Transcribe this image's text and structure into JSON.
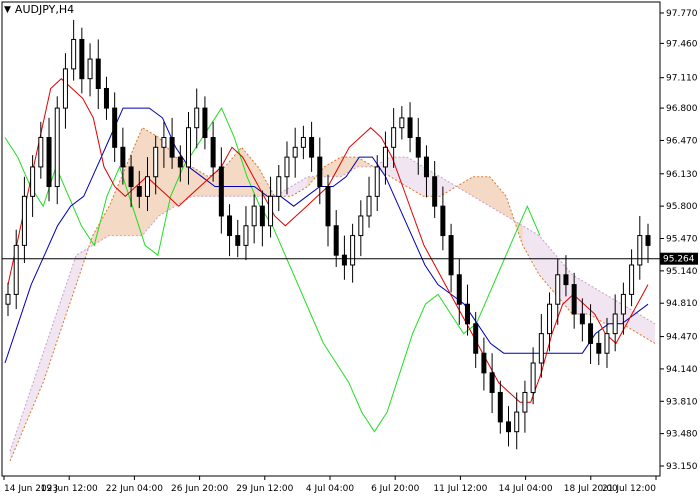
{
  "symbol_label": "AUDJPY,H4",
  "colors": {
    "background": "#ffffff",
    "candles": "#000000",
    "tenkan": "#e00000",
    "kijun": "#0000b4",
    "chikou": "#22dd22",
    "senkou_a": "#d8782c",
    "senkou_b": "#c8a0c8",
    "price_badge": "#000000"
  },
  "chart_data": {
    "type": "candlestick",
    "title": "AUDJPY,H4",
    "grid": false,
    "ylim": [
      93.15,
      97.78
    ],
    "y_ticks": [
      "97.770",
      "97.460",
      "97.110",
      "96.800",
      "96.470",
      "96.130",
      "95.800",
      "95.470",
      "95.140",
      "94.810",
      "94.470",
      "94.140",
      "93.810",
      "93.480",
      "93.150"
    ],
    "x_ticks": [
      "14 Jun 2023",
      "19 Jun 12:00",
      "22 Jun 04:00",
      "26 Jun 20:00",
      "29 Jun 12:00",
      "4 Jul 04:00",
      "6 Jul 20:00",
      "11 Jul 12:00",
      "14 Jul 04:00",
      "18 Jul 20:00",
      "21 Jul 12:00"
    ],
    "current_price": 95.264,
    "current_price_label": "95.264",
    "series": [
      {
        "name": "price",
        "kind": "ohlc_close_path",
        "close": [
          94.9,
          95.4,
          95.9,
          96.2,
          96.5,
          96.0,
          96.8,
          97.2,
          97.5,
          97.1,
          97.3,
          97.0,
          96.8,
          96.4,
          96.2,
          96.0,
          95.9,
          96.1,
          96.4,
          96.5,
          96.3,
          96.2,
          96.6,
          96.8,
          96.5,
          96.2,
          95.7,
          95.5,
          95.4,
          95.6,
          95.8,
          95.6,
          95.9,
          96.1,
          96.3,
          96.4,
          96.5,
          96.3,
          96.0,
          95.6,
          95.3,
          95.2,
          95.5,
          95.7,
          95.9,
          96.2,
          96.4,
          96.6,
          96.7,
          96.5,
          96.3,
          96.1,
          95.8,
          95.5,
          95.1,
          94.8,
          94.6,
          94.3,
          94.1,
          93.9,
          93.6,
          93.5,
          93.7,
          93.9,
          94.2,
          94.5,
          94.8,
          95.1,
          95.0,
          94.7,
          94.6,
          94.4,
          94.3,
          94.5,
          94.7,
          94.9,
          95.2,
          95.5,
          95.4
        ]
      },
      {
        "name": "tenkan",
        "values": [
          95.0,
          95.5,
          96.0,
          96.5,
          97.0,
          97.1,
          97.0,
          96.9,
          96.7,
          96.2,
          96.0,
          95.9,
          96.0,
          96.1,
          96.0,
          95.9,
          95.8,
          95.9,
          96.0,
          96.1,
          96.2,
          96.4,
          96.3,
          96.1,
          95.9,
          95.7,
          95.6,
          95.7,
          95.8,
          95.9,
          96.0,
          96.2,
          96.4,
          96.5,
          96.6,
          96.5,
          96.3,
          96.0,
          95.7,
          95.4,
          95.2,
          95.0,
          94.8,
          94.6,
          94.4,
          94.2,
          94.0,
          93.9,
          93.8,
          93.8,
          94.1,
          94.5,
          94.8,
          94.9,
          94.8,
          94.7,
          94.5,
          94.4,
          94.6,
          94.8,
          95.0
        ]
      },
      {
        "name": "kijun",
        "values": [
          94.2,
          94.6,
          95.0,
          95.3,
          95.6,
          95.8,
          95.9,
          96.2,
          96.5,
          96.8,
          96.8,
          96.8,
          96.7,
          96.4,
          96.2,
          96.1,
          96.0,
          96.0,
          96.0,
          96.0,
          95.9,
          95.9,
          95.8,
          95.9,
          96.0,
          96.0,
          96.1,
          96.3,
          96.3,
          96.1,
          95.8,
          95.5,
          95.2,
          95.0,
          94.9,
          94.8,
          94.6,
          94.4,
          94.3,
          94.3,
          94.3,
          94.3,
          94.3,
          94.3,
          94.3,
          94.5,
          94.6,
          94.6,
          94.7,
          94.8
        ]
      },
      {
        "name": "chikou",
        "values": [
          96.5,
          96.3,
          96.0,
          95.8,
          96.2,
          95.9,
          95.6,
          95.4,
          95.9,
          96.2,
          95.8,
          95.4,
          95.3,
          95.9,
          96.2,
          96.4,
          96.6,
          96.8,
          96.5,
          96.1,
          95.8,
          95.6,
          95.3,
          95.0,
          94.7,
          94.4,
          94.2,
          94.0,
          93.7,
          93.5,
          93.7,
          94.1,
          94.5,
          94.8,
          94.9,
          94.7,
          94.5,
          94.6,
          94.9,
          95.2,
          95.5,
          95.8,
          95.5
        ]
      },
      {
        "name": "senkou_a",
        "values": [
          93.2,
          93.6,
          94.0,
          94.5,
          95.0,
          95.5,
          95.8,
          96.2,
          96.6,
          96.5,
          96.3,
          96.2,
          96.1,
          96.2,
          96.4,
          96.2,
          95.9,
          95.9,
          96.0,
          96.2,
          96.3,
          96.3,
          96.2,
          96.1,
          96.0,
          95.9,
          95.9,
          96.0,
          96.1,
          96.1,
          95.9,
          95.4,
          95.1,
          94.9,
          94.7,
          94.7,
          94.6,
          94.6,
          94.5,
          94.4
        ]
      },
      {
        "name": "senkou_b",
        "values": [
          93.3,
          93.8,
          94.3,
          94.8,
          95.3,
          95.4,
          95.5,
          95.5,
          95.5,
          95.7,
          95.8,
          95.9,
          95.9,
          95.9,
          95.9,
          95.9,
          95.9,
          96.0,
          96.1,
          96.1,
          96.1,
          96.2,
          96.2,
          96.3,
          96.3,
          96.2,
          96.1,
          96.0,
          95.9,
          95.8,
          95.7,
          95.6,
          95.5,
          95.3,
          95.1,
          95.0,
          94.9,
          94.8,
          94.7,
          94.6
        ]
      }
    ]
  }
}
